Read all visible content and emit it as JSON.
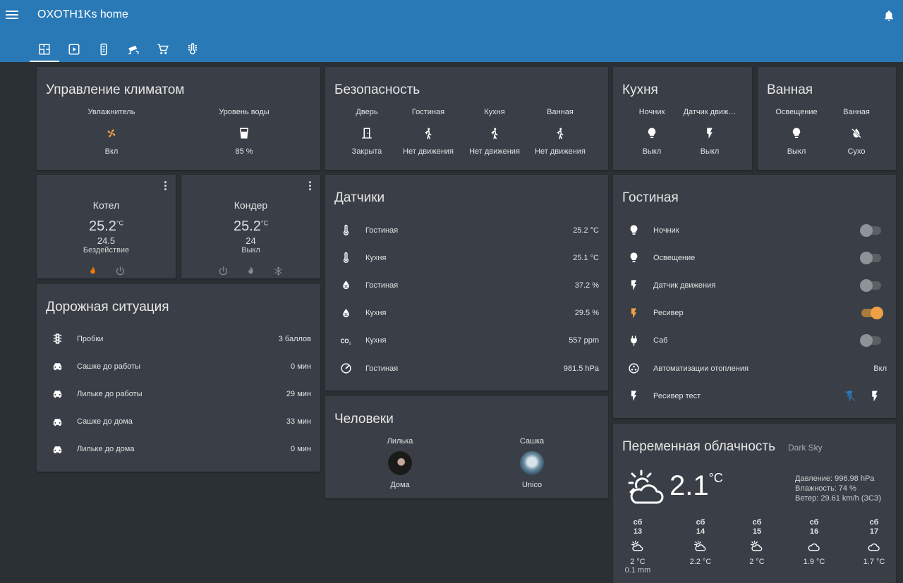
{
  "app": {
    "title": "OXOTH1Ks home"
  },
  "tabs": [
    {
      "icon": "floorplan-icon"
    },
    {
      "icon": "play-icon"
    },
    {
      "icon": "remote-icon"
    },
    {
      "icon": "cctv-icon"
    },
    {
      "icon": "cart-icon"
    },
    {
      "icon": "thermometer-lines-icon"
    }
  ],
  "climate": {
    "title": "Управление климатом",
    "items": [
      {
        "name": "Увлажнитель",
        "icon": "fan-icon",
        "state": "Вкл",
        "color": "#f0a046"
      },
      {
        "name": "Уровень воды",
        "icon": "cup-icon",
        "state": "85 %"
      }
    ]
  },
  "security": {
    "title": "Безопасность",
    "items": [
      {
        "name": "Дверь",
        "icon": "door-icon",
        "state": "Закрыта"
      },
      {
        "name": "Гостиная",
        "icon": "walk-icon",
        "state": "Нет движения"
      },
      {
        "name": "Кухня",
        "icon": "walk-icon",
        "state": "Нет движения"
      },
      {
        "name": "Ванная",
        "icon": "walk-icon",
        "state": "Нет движения"
      }
    ]
  },
  "kitchen": {
    "title": "Кухня",
    "items": [
      {
        "name": "Ночник",
        "icon": "bulb-icon",
        "state": "Выкл"
      },
      {
        "name": "Датчик движ…",
        "icon": "flash-icon",
        "state": "Выкл"
      }
    ]
  },
  "bathroom": {
    "title": "Ванная",
    "items": [
      {
        "name": "Освещение",
        "icon": "bulb-icon",
        "state": "Выкл"
      },
      {
        "name": "Ванная",
        "icon": "water-off-icon",
        "state": "Сухо"
      }
    ]
  },
  "thermostats": [
    {
      "name": "Котел",
      "current": "25.2",
      "unit": "°C",
      "target": "24.5",
      "mode": "Бездействие",
      "accent": "#f57c00",
      "level": 0.55,
      "buttons": [
        "fire-icon",
        "power-icon"
      ]
    },
    {
      "name": "Кондер",
      "current": "25.2",
      "unit": "°C",
      "target": "24",
      "mode": "Выкл",
      "accent": "#9e9e9e",
      "level": 0.5,
      "buttons": [
        "power-icon",
        "fire-icon",
        "snowflake-icon"
      ]
    }
  ],
  "traffic": {
    "title": "Дорожная ситуация",
    "rows": [
      {
        "icon": "traffic-light-icon",
        "label": "Пробки",
        "value": "3 баллов"
      },
      {
        "icon": "car-icon",
        "label": "Сашке до работы",
        "value": "0 мин"
      },
      {
        "icon": "car-icon",
        "label": "Лильке до работы",
        "value": "29 мин"
      },
      {
        "icon": "car-icon",
        "label": "Сашке до дома",
        "value": "33 мин"
      },
      {
        "icon": "car-icon",
        "label": "Лильке до дома",
        "value": "0 мин"
      }
    ]
  },
  "sensors": {
    "title": "Датчики",
    "rows": [
      {
        "icon": "thermometer-icon",
        "label": "Гостиная",
        "value": "25.2 °C"
      },
      {
        "icon": "thermometer-icon",
        "label": "Кухня",
        "value": "25.1 °C"
      },
      {
        "icon": "water-percent-icon",
        "label": "Гостиная",
        "value": "37.2 %"
      },
      {
        "icon": "water-percent-icon",
        "label": "Кухня",
        "value": "29.5 %"
      },
      {
        "icon": "co2-icon",
        "label": "Кухня",
        "value": "557 ppm"
      },
      {
        "icon": "gauge-icon",
        "label": "Гостиная",
        "value": "981.5 hPa"
      }
    ]
  },
  "people": {
    "title": "Человеки",
    "items": [
      {
        "name": "Лилька",
        "state": "Дома"
      },
      {
        "name": "Сашка",
        "state": "Unico"
      }
    ]
  },
  "living": {
    "title": "Гостиная",
    "rows": [
      {
        "icon": "bulb-icon",
        "label": "Ночник",
        "type": "toggle",
        "on": false
      },
      {
        "icon": "bulb-icon",
        "label": "Освещение",
        "type": "toggle",
        "on": false
      },
      {
        "icon": "flash-icon",
        "label": "Датчик движения",
        "type": "toggle",
        "on": false
      },
      {
        "icon": "flash-icon",
        "label": "Ресивер",
        "type": "toggle",
        "on": true,
        "color": "#f0a046"
      },
      {
        "icon": "plug-icon",
        "label": "Саб",
        "type": "toggle",
        "on": false
      },
      {
        "icon": "automation-icon",
        "label": "Автоматизации отопления",
        "type": "text",
        "value": "Вкл"
      },
      {
        "icon": "flash-icon",
        "label": "Ресивер тест",
        "type": "buttons"
      }
    ]
  },
  "weather": {
    "title": "Переменная облачность",
    "source": "Dark Sky",
    "temp": "2.1",
    "unit": "°C",
    "details": [
      "Давление: 996.98 hPa",
      "Влажность: 74 %",
      "Ветер: 29.61 km/h (ЗСЗ)"
    ],
    "forecast": [
      {
        "day": "сб",
        "date": "13",
        "icon": "partly-cloudy-icon",
        "temp": "2 °C",
        "precip": "0.1 mm"
      },
      {
        "day": "сб",
        "date": "14",
        "icon": "partly-cloudy-icon",
        "temp": "2.2 °C"
      },
      {
        "day": "сб",
        "date": "15",
        "icon": "partly-cloudy-icon",
        "temp": "2 °C"
      },
      {
        "day": "сб",
        "date": "16",
        "icon": "cloud-icon",
        "temp": "1.9 °C"
      },
      {
        "day": "сб",
        "date": "17",
        "icon": "cloud-icon",
        "temp": "1.7 °C"
      }
    ]
  }
}
